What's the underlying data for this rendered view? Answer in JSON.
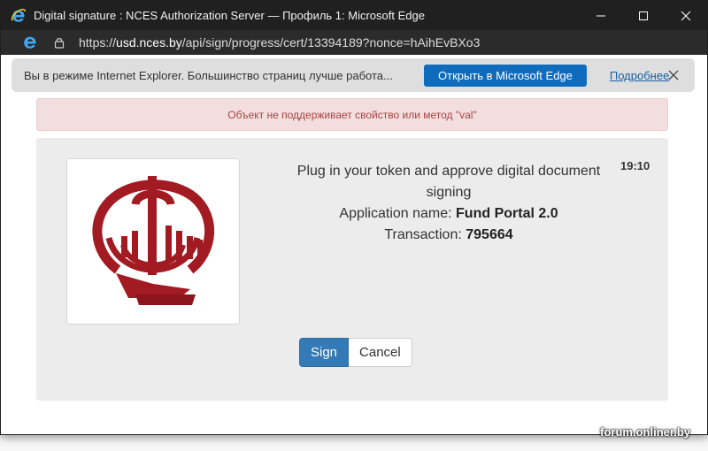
{
  "window": {
    "title": "Digital signature : NCES Authorization Server — Профиль 1: Microsoft Edge",
    "controls": {
      "minimize": "—",
      "maximize": "☐",
      "close": "✕"
    }
  },
  "address": {
    "url_prefix": "https://",
    "url_domain": "usd.nces.by",
    "url_path": "/api/sign/progress/cert/13394189?nonce=hAihEvBXo3"
  },
  "infobar": {
    "text": "Вы в режиме Internet Explorer. Большинство страниц лучше работа...",
    "open_button": "Открыть в Microsoft Edge",
    "more_link": "Подробнее"
  },
  "error": {
    "message": "Объект не поддерживает свойство или метод \"val\""
  },
  "sign_panel": {
    "line1": "Plug in your token and approve digital document signing",
    "app_label": "Application name:",
    "app_value": "Fund Portal 2.0",
    "tx_label": "Transaction:",
    "tx_value": "795664",
    "timer": "19:10",
    "sign_button": "Sign",
    "cancel_button": "Cancel"
  },
  "watermark": "forum.onliner.by",
  "colors": {
    "titlebar": "#202020",
    "accent": "#0f6cbd",
    "sign_button": "#337ab7",
    "error_bg": "#f2dede",
    "error_text": "#a94442",
    "logo": "#a31b22"
  },
  "icons": {
    "title": "ie-icon",
    "lock": "lock-icon",
    "close": "close-icon",
    "logo": "nces-emblem-logo"
  }
}
